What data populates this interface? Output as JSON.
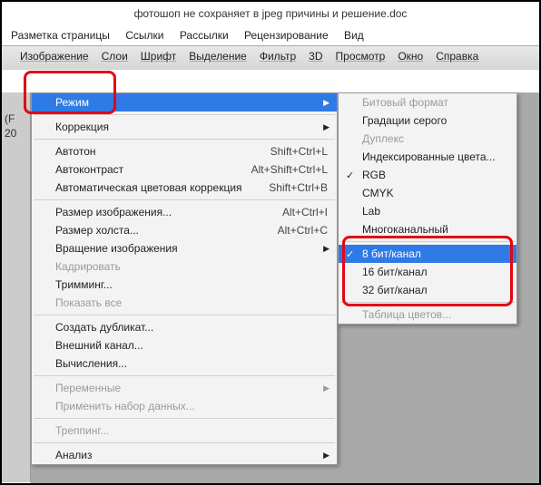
{
  "title": "фотошоп не сохраняет в jpeg причины и решение.doc",
  "topmenu": [
    "Разметка страницы",
    "Ссылки",
    "Рассылки",
    "Рецензирование",
    "Вид"
  ],
  "menubar": [
    "Изображение",
    "Слои",
    "Шрифт",
    "Выделение",
    "Фильтр",
    "3D",
    "Просмотр",
    "Окно",
    "Справка"
  ],
  "side": {
    "l1": "(F",
    "l2": "20"
  },
  "menu": {
    "mode": "Режим",
    "correction": "Коррекция",
    "autotone": {
      "label": "Автотон",
      "sc": "Shift+Ctrl+L"
    },
    "autocontrast": {
      "label": "Автоконтраст",
      "sc": "Alt+Shift+Ctrl+L"
    },
    "autocolor": {
      "label": "Автоматическая цветовая коррекция",
      "sc": "Shift+Ctrl+B"
    },
    "imgsize": {
      "label": "Размер изображения...",
      "sc": "Alt+Ctrl+I"
    },
    "canvassize": {
      "label": "Размер холста...",
      "sc": "Alt+Ctrl+C"
    },
    "rotate": "Вращение изображения",
    "crop": "Кадрировать",
    "trim": "Тримминг...",
    "showall": "Показать все",
    "duplicate": "Создать дубликат...",
    "apply": "Внешний канал...",
    "calc": "Вычисления...",
    "vars": "Переменные",
    "dataset": "Применить набор данных...",
    "trap": "Треппинг...",
    "analysis": "Анализ"
  },
  "submenu": {
    "bitmap": "Битовый формат",
    "grayscale": "Градации серого",
    "duplex": "Дуплекс",
    "indexed": "Индексированные цвета...",
    "rgb": "RGB",
    "cmyk": "CMYK",
    "lab": "Lab",
    "multi": "Многоканальный",
    "bit8": "8 бит/канал",
    "bit16": "16 бит/канал",
    "bit32": "32 бит/канал",
    "colortable": "Таблица цветов..."
  }
}
